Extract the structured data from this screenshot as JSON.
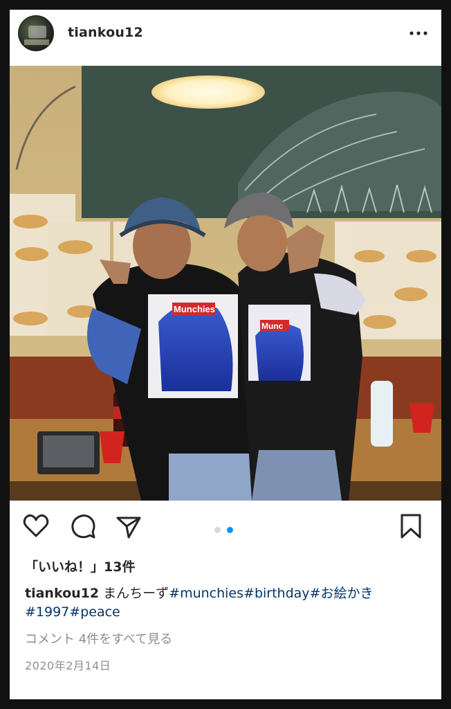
{
  "post": {
    "username": "tiankou12",
    "avatar_icon": "profile-avatar",
    "more_icon": "ellipsis-horizontal-icon",
    "photo": {
      "alt_icon": "party-photo",
      "shirt_text_left": "Munchies",
      "shirt_text_right": "Munc"
    },
    "carousel": {
      "count": 2,
      "active": 2,
      "active_color": "#0095f6",
      "inactive_color": "#d8d8d8"
    },
    "actions": {
      "like_icon": "heart-icon",
      "comment_icon": "comment-bubble-icon",
      "share_icon": "paper-plane-icon",
      "save_icon": "bookmark-icon"
    },
    "likes_text": "「いいね！」13件",
    "caption": {
      "username": "tiankou12",
      "text": "まんちーず",
      "hashtags_line1": [
        "#munchies",
        "#birthday",
        "#お絵かき"
      ],
      "hashtags_line2": [
        "#1997",
        "#peace"
      ]
    },
    "view_comments": "コメント 4件をすべて見る",
    "date": "2020年2月14日"
  },
  "colors": {
    "text": "#262626",
    "muted": "#8e8e8e",
    "hashtag": "#003569",
    "frame": "#111111"
  }
}
